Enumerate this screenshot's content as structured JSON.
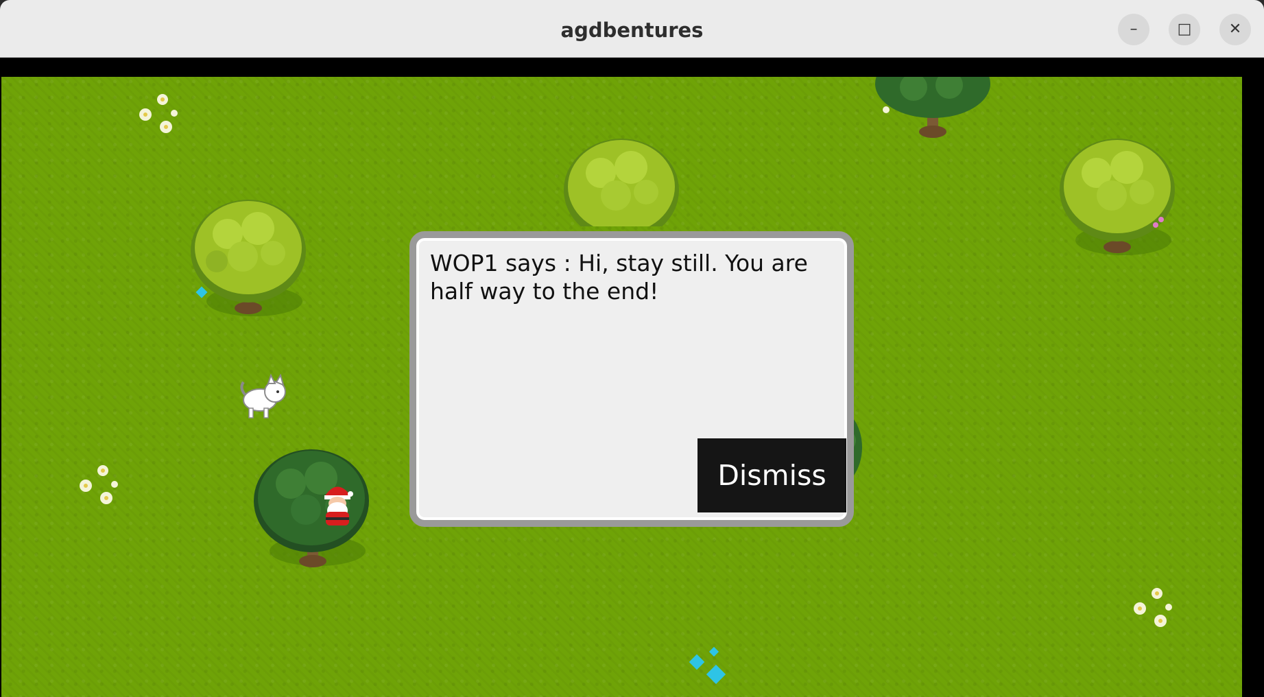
{
  "window": {
    "title": "agdbentures"
  },
  "dialog": {
    "message": "WOP1 says : Hi, stay still. You are half way to the end!",
    "dismiss_label": "Dismiss"
  }
}
